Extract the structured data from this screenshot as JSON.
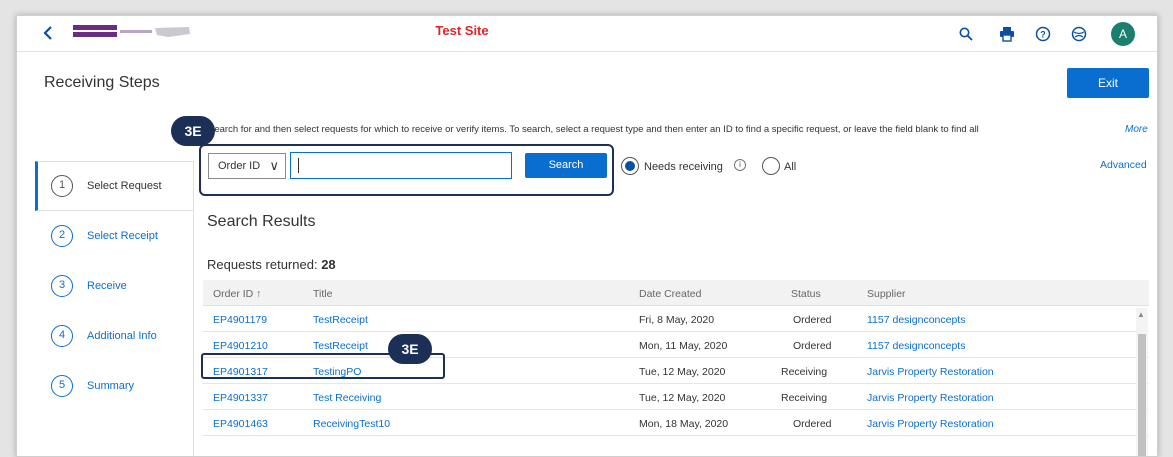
{
  "header": {
    "site_title": "Test Site",
    "avatar_initial": "A",
    "icons": [
      "back-icon",
      "search-icon",
      "print-icon",
      "help-icon",
      "globe-icon"
    ]
  },
  "page": {
    "title": "Receiving Steps",
    "exit_label": "Exit",
    "instructions": "Search for and then select requests for which to receive or verify items. To search, select a request type and then enter an ID to find a specific request, or leave the field blank to find all",
    "more_label": "More",
    "advanced_label": "Advanced"
  },
  "steps": [
    {
      "num": "1",
      "label": "Select Request"
    },
    {
      "num": "2",
      "label": "Select Receipt"
    },
    {
      "num": "3",
      "label": "Receive"
    },
    {
      "num": "4",
      "label": "Additional Info"
    },
    {
      "num": "5",
      "label": "Summary"
    }
  ],
  "search": {
    "type_selected": "Order ID",
    "input_value": "",
    "button_label": "Search",
    "radio_needs_receiving": "Needs receiving",
    "radio_all": "All",
    "selected_radio": "Needs receiving"
  },
  "badges": [
    "3E",
    "3E"
  ],
  "results": {
    "title": "Search Results",
    "count_label": "Requests returned:",
    "count": "28",
    "columns": [
      "Order ID ↑",
      "Title",
      "Date Created",
      "Status",
      "Supplier"
    ],
    "rows": [
      [
        "EP4901179",
        "TestReceipt",
        "Fri, 8 May, 2020",
        "Ordered",
        "1157 designconcepts"
      ],
      [
        "EP4901210",
        "TestReceipt",
        "Mon, 11 May, 2020",
        "Ordered",
        "1157 designconcepts"
      ],
      [
        "EP4901317",
        "TestingPO",
        "Tue, 12 May, 2020",
        "Receiving",
        "Jarvis Property Restoration"
      ],
      [
        "EP4901337",
        "Test Receiving",
        "Tue, 12 May, 2020",
        "Receiving",
        "Jarvis Property Restoration"
      ],
      [
        "EP4901463",
        "ReceivingTest10",
        "Mon, 18 May, 2020",
        "Ordered",
        "Jarvis Property Restoration"
      ]
    ]
  },
  "colors": {
    "accent": "#0a6ed1",
    "badge": "#1b2f57",
    "site_title": "#e0242a",
    "avatar": "#1a7f6e"
  }
}
